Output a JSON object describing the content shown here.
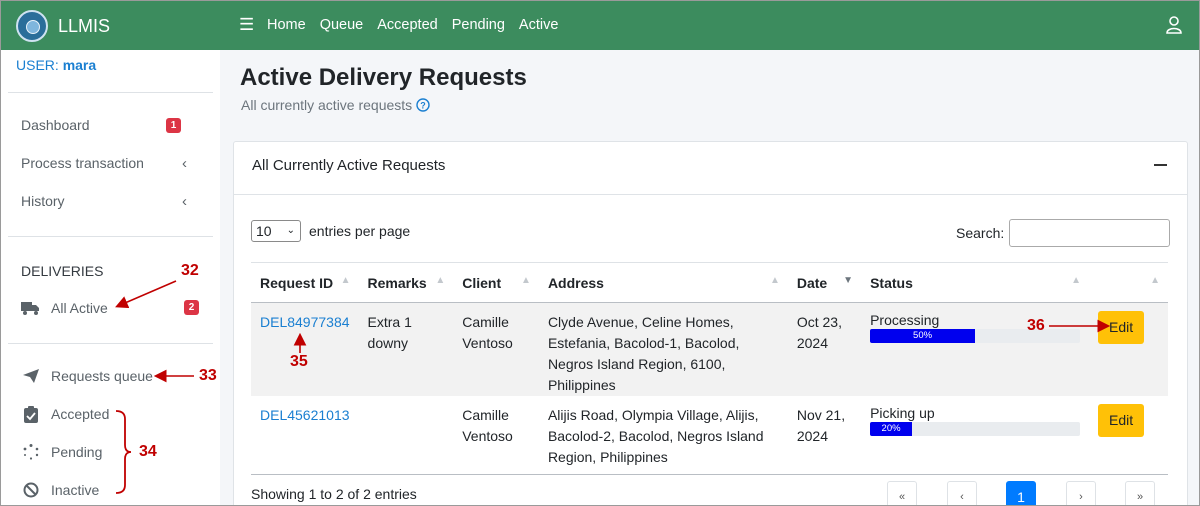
{
  "app": {
    "name": "LLMIS"
  },
  "topnav": {
    "items": [
      "Home",
      "Queue",
      "Accepted",
      "Pending",
      "Active"
    ]
  },
  "sidebar": {
    "user_label": "USER:",
    "user_name": "mara",
    "items": [
      {
        "label": "Dashboard",
        "badge": "1"
      },
      {
        "label": "Process transaction"
      },
      {
        "label": "History"
      }
    ],
    "section": "DELIVERIES",
    "deliveries": [
      {
        "label": "All Active",
        "badge": "2",
        "icon": "truck-icon"
      },
      {
        "label": "Requests queue",
        "icon": "paper-plane-icon"
      },
      {
        "label": "Accepted",
        "icon": "clipboard-check-icon"
      },
      {
        "label": "Pending",
        "icon": "spinner-icon"
      },
      {
        "label": "Inactive",
        "icon": "ban-icon"
      }
    ]
  },
  "page": {
    "title": "Active Delivery Requests",
    "subtitle": "All currently active requests"
  },
  "card": {
    "title": "All Currently Active Requests",
    "entries_value": "10",
    "entries_label": "entries per page",
    "search_label": "Search:",
    "search_value": ""
  },
  "table": {
    "columns": [
      "Request ID",
      "Remarks",
      "Client",
      "Address",
      "Date",
      "Status"
    ],
    "rows": [
      {
        "id": "DEL84977384",
        "remarks": "Extra 1 downy",
        "client": "Camille Ventoso",
        "address": "Clyde Avenue, Celine Homes, Estefania, Bacolod-1, Bacolod, Negros Island Region, 6100, Philippines",
        "date": "Oct 23, 2024",
        "status": "Processing",
        "progress": 50,
        "progress_label": "50%",
        "action": "Edit"
      },
      {
        "id": "DEL45621013",
        "remarks": "",
        "client": "Camille Ventoso",
        "address": "Alijis Road, Olympia Village, Alijis, Bacolod-2, Bacolod, Negros Island Region, Philippines",
        "date": "Nov 21, 2024",
        "status": "Picking up",
        "progress": 20,
        "progress_label": "20%",
        "action": "Edit"
      }
    ]
  },
  "footer": {
    "showing": "Showing 1 to 2 of 2 entries",
    "pages": [
      "«",
      "‹",
      "1",
      "›",
      "»"
    ]
  },
  "annotations": [
    "32",
    "33",
    "34",
    "35",
    "36"
  ],
  "colors": {
    "topbar": "#3c8c5e",
    "link": "#1a7fd1",
    "badge": "#dc3545",
    "edit_button": "#ffc107",
    "progress_bar": "#0000ee",
    "annotation": "#c00000"
  }
}
